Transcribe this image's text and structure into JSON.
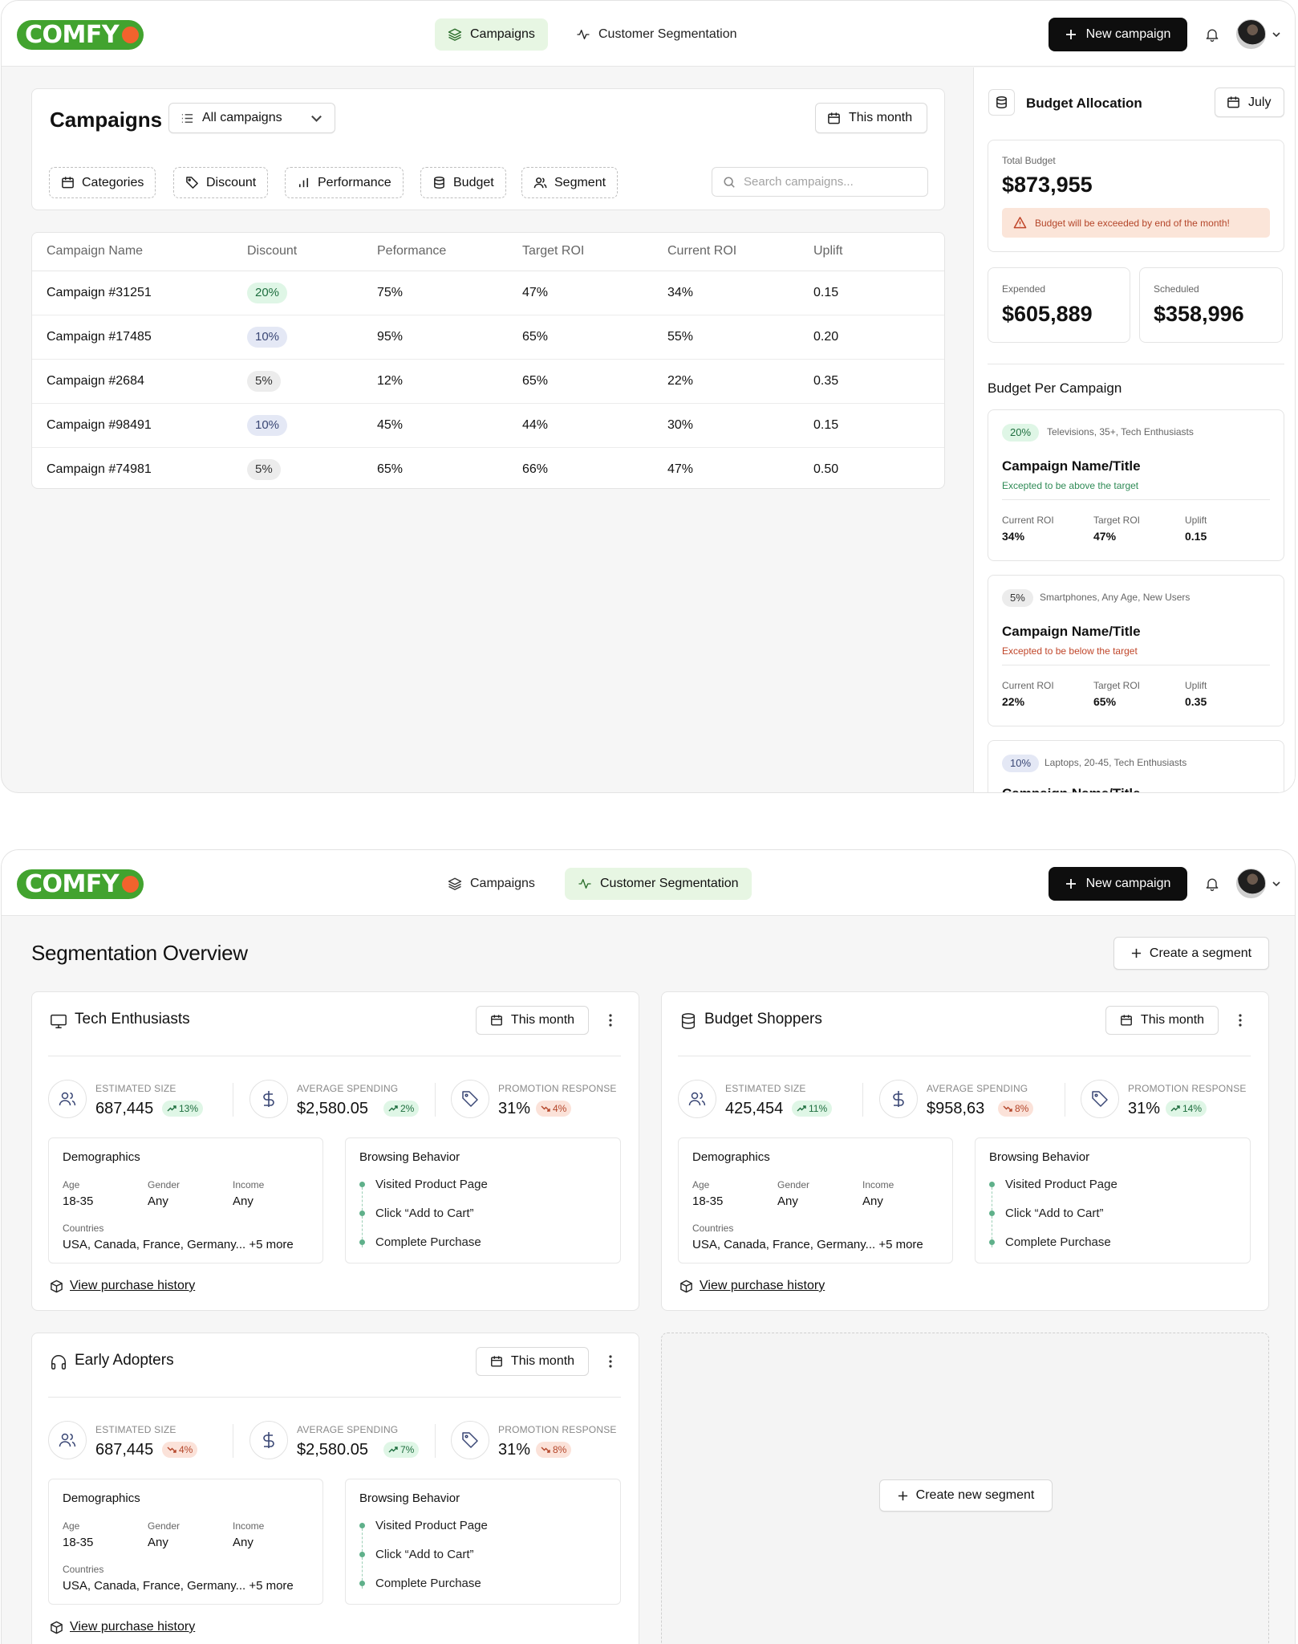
{
  "brand": {
    "logo_text": "COMFY",
    "green": "#42a32f",
    "orange": "#f2632d"
  },
  "nav": {
    "campaigns": "Campaigns",
    "segmentation": "Customer Segmentation",
    "new_campaign": "New campaign"
  },
  "campaigns": {
    "title": "Campaigns",
    "filter_select": "All campaigns",
    "period": "This month",
    "chips": [
      "Categories",
      "Discount",
      "Performance",
      "Budget",
      "Segment"
    ],
    "search_placeholder": "Search campaigns...",
    "columns": [
      "Campaign Name",
      "Discount",
      "Peformance",
      "Target ROI",
      "Current ROI",
      "Uplift"
    ],
    "rows": [
      {
        "name": "Campaign #31251",
        "discount": "20%",
        "performance": "75%",
        "target_roi": "47%",
        "current_roi": "34%",
        "uplift": "0.15"
      },
      {
        "name": "Campaign #17485",
        "discount": "10%",
        "performance": "95%",
        "target_roi": "65%",
        "current_roi": "55%",
        "uplift": "0.20"
      },
      {
        "name": "Campaign #2684",
        "discount": "5%",
        "performance": "12%",
        "target_roi": "65%",
        "current_roi": "22%",
        "uplift": "0.35"
      },
      {
        "name": "Campaign #98491",
        "discount": "10%",
        "performance": "45%",
        "target_roi": "44%",
        "current_roi": "30%",
        "uplift": "0.15"
      },
      {
        "name": "Campaign #74981",
        "discount": "5%",
        "performance": "65%",
        "target_roi": "66%",
        "current_roi": "47%",
        "uplift": "0.50"
      }
    ]
  },
  "budget": {
    "title": "Budget Allocation",
    "month": "July",
    "total_label": "Total Budget",
    "total": "$873,955",
    "warning": "Budget will be exceeded by end of the month!",
    "expended_label": "Expended",
    "expended": "$605,889",
    "scheduled_label": "Scheduled",
    "scheduled": "$358,996",
    "per_campaign_title": "Budget Per Campaign",
    "campaign_cards": [
      {
        "discount": "20%",
        "tags": "Televisions, 35+, Tech Enthusiasts",
        "name": "Campaign Name/Title",
        "note": "Excepted to be above the target",
        "current_roi_label": "Current ROI",
        "current_roi": "34%",
        "target_roi_label": "Target ROI",
        "target_roi": "47%",
        "uplift_label": "Uplift",
        "uplift": "0.15"
      },
      {
        "discount": "5%",
        "tags": "Smartphones, Any Age, New Users",
        "name": "Campaign Name/Title",
        "note": "Excepted to be below the target",
        "current_roi_label": "Current ROI",
        "current_roi": "22%",
        "target_roi_label": "Target ROI",
        "target_roi": "65%",
        "uplift_label": "Uplift",
        "uplift": "0.35"
      },
      {
        "discount": "10%",
        "tags": "Laptops, 20-45, Tech Enthusiasts",
        "name": "Campaign Name/Title"
      }
    ]
  },
  "segmentation": {
    "title": "Segmentation Overview",
    "create_segment": "Create a segment",
    "create_new_segment": "Create new segment",
    "labels": {
      "size": "ESTIMATED SIZE",
      "spending": "AVERAGE SPENDING",
      "response": "PROMOTION RESPONSE",
      "demographics": "Demographics",
      "age": "Age",
      "gender": "Gender",
      "income": "Income",
      "countries": "Countries",
      "browsing": "Browsing Behavior",
      "view_history": "View purchase history",
      "period": "This month"
    },
    "segments": [
      {
        "name": "Tech Enthusiasts",
        "icon": "monitor-icon",
        "size": "687,445",
        "size_delta": "13%",
        "spending": "$2,580.05",
        "spending_delta": "2%",
        "response": "31%",
        "response_delta": "4%",
        "age": "18-35",
        "gender": "Any",
        "income": "Any",
        "countries": "USA, Canada, France, Germany... +5 more",
        "steps": [
          "Visited Product Page",
          "Click “Add to Cart”",
          "Complete Purchase"
        ]
      },
      {
        "name": "Budget Shoppers",
        "icon": "database-icon",
        "size": "425,454",
        "size_delta": "11%",
        "spending": "$958,63",
        "spending_delta": "8%",
        "response": "31%",
        "response_delta": "14%",
        "age": "18-35",
        "gender": "Any",
        "income": "Any",
        "countries": "USA, Canada, France, Germany... +5 more",
        "steps": [
          "Visited Product Page",
          "Click “Add to Cart”",
          "Complete Purchase"
        ]
      },
      {
        "name": "Early Adopters",
        "icon": "headphones-icon",
        "size": "687,445",
        "size_delta": "4%",
        "spending": "$2,580.05",
        "spending_delta": "7%",
        "response": "31%",
        "response_delta": "8%",
        "age": "18-35",
        "gender": "Any",
        "income": "Any",
        "countries": "USA, Canada, France, Germany... +5 more",
        "steps": [
          "Visited Product Page",
          "Click “Add to Cart”",
          "Complete Purchase"
        ]
      }
    ]
  }
}
